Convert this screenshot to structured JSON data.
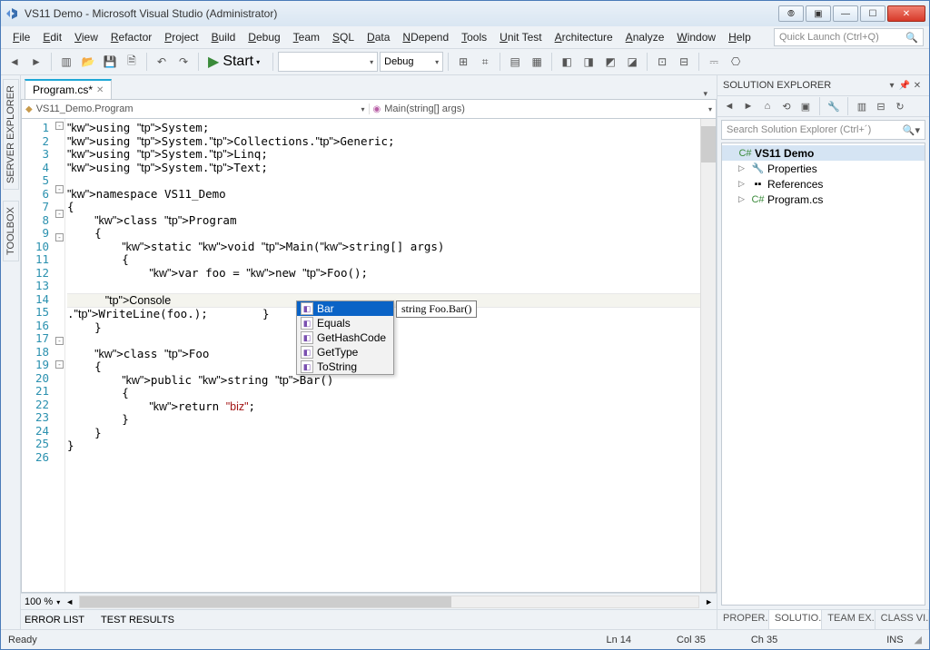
{
  "window": {
    "title": "VS11 Demo - Microsoft Visual Studio (Administrator)"
  },
  "menu": {
    "items": [
      "File",
      "Edit",
      "View",
      "Refactor",
      "Project",
      "Build",
      "Debug",
      "Team",
      "SQL",
      "Data",
      "NDepend",
      "Tools",
      "Unit Test",
      "Architecture",
      "Analyze",
      "Window",
      "Help"
    ]
  },
  "quicklaunch": {
    "placeholder": "Quick Launch (Ctrl+Q)"
  },
  "toolbar": {
    "start": "Start",
    "config": "Debug",
    "platform": ""
  },
  "leftdock": {
    "tabs": [
      "SERVER EXPLORER",
      "TOOLBOX"
    ]
  },
  "doc": {
    "tab": "Program.cs*",
    "nav_left": "VS11_Demo.Program",
    "nav_right": "Main(string[] args)"
  },
  "code": {
    "lines": [
      {
        "n": 1,
        "t": "using System;"
      },
      {
        "n": 2,
        "t": "using System.Collections.Generic;"
      },
      {
        "n": 3,
        "t": "using System.Linq;"
      },
      {
        "n": 4,
        "t": "using System.Text;"
      },
      {
        "n": 5,
        "t": ""
      },
      {
        "n": 6,
        "t": "namespace VS11_Demo"
      },
      {
        "n": 7,
        "t": "{"
      },
      {
        "n": 8,
        "t": "    class Program"
      },
      {
        "n": 9,
        "t": "    {"
      },
      {
        "n": 10,
        "t": "        static void Main(string[] args)"
      },
      {
        "n": 11,
        "t": "        {"
      },
      {
        "n": 12,
        "t": "            var foo = new Foo();"
      },
      {
        "n": 13,
        "t": ""
      },
      {
        "n": 14,
        "t": "            Console.WriteLine(foo.);"
      },
      {
        "n": 15,
        "t": "        }"
      },
      {
        "n": 16,
        "t": "    }"
      },
      {
        "n": 17,
        "t": ""
      },
      {
        "n": 18,
        "t": "    class Foo"
      },
      {
        "n": 19,
        "t": "    {"
      },
      {
        "n": 20,
        "t": "        public string Bar()"
      },
      {
        "n": 21,
        "t": "        {"
      },
      {
        "n": 22,
        "t": "            return \"biz\";"
      },
      {
        "n": 23,
        "t": "        }"
      },
      {
        "n": 24,
        "t": "    }"
      },
      {
        "n": 25,
        "t": "}"
      },
      {
        "n": 26,
        "t": ""
      }
    ]
  },
  "intellisense": {
    "items": [
      "Bar",
      "Equals",
      "GetHashCode",
      "GetType",
      "ToString"
    ],
    "selected": 0,
    "tooltip": "string Foo.Bar()"
  },
  "zoom": "100 %",
  "solution": {
    "title": "SOLUTION EXPLORER",
    "search_placeholder": "Search Solution Explorer (Ctrl+´)",
    "root": "VS11 Demo",
    "children": [
      "Properties",
      "References",
      "Program.cs"
    ]
  },
  "bottom_right_tabs": [
    "PROPER...",
    "SOLUTIO...",
    "TEAM EX...",
    "CLASS VI..."
  ],
  "error_tabs": [
    "ERROR LIST",
    "TEST RESULTS"
  ],
  "status": {
    "ready": "Ready",
    "ln": "Ln 14",
    "col": "Col 35",
    "ch": "Ch 35",
    "ins": "INS"
  }
}
